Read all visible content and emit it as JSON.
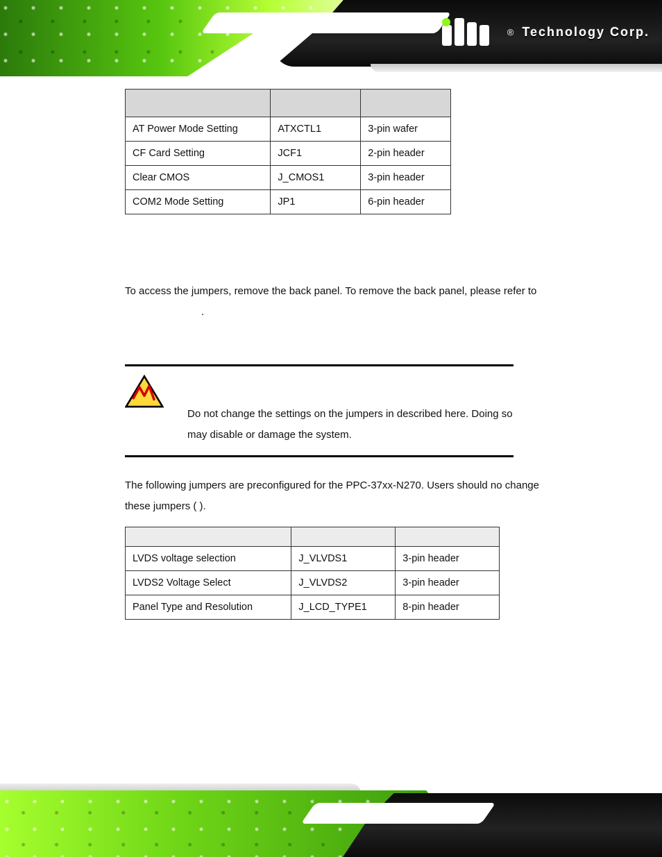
{
  "header": {
    "brand": "Technology Corp.",
    "registered": "®"
  },
  "table1": {
    "headers": [
      "",
      "",
      ""
    ],
    "rows": [
      [
        "AT Power Mode Setting",
        "ATXCTL1",
        "3-pin wafer"
      ],
      [
        "CF Card Setting",
        "JCF1",
        "2-pin header"
      ],
      [
        "Clear CMOS",
        "J_CMOS1",
        "3-pin header"
      ],
      [
        "COM2 Mode Setting",
        "JP1",
        "6-pin header"
      ]
    ]
  },
  "paragraphs": {
    "access_line1": "To access the jumpers, remove the back panel. To remove the back panel, please refer to",
    "access_line2": ".",
    "preconf_line1": "The following jumpers are preconfigured for the PPC-37xx-N270. Users should no change",
    "preconf_line2": "these jumpers (                )."
  },
  "warning": {
    "line1": "Do not change the settings on the jumpers in described here. Doing so",
    "line2": "may disable or damage the system."
  },
  "table2": {
    "headers": [
      "",
      "",
      ""
    ],
    "rows": [
      [
        "LVDS voltage selection",
        "J_VLVDS1",
        "3-pin header"
      ],
      [
        "LVDS2 Voltage Select",
        "J_VLVDS2",
        "3-pin header"
      ],
      [
        "Panel Type and Resolution",
        "J_LCD_TYPE1",
        "8-pin header"
      ]
    ]
  }
}
